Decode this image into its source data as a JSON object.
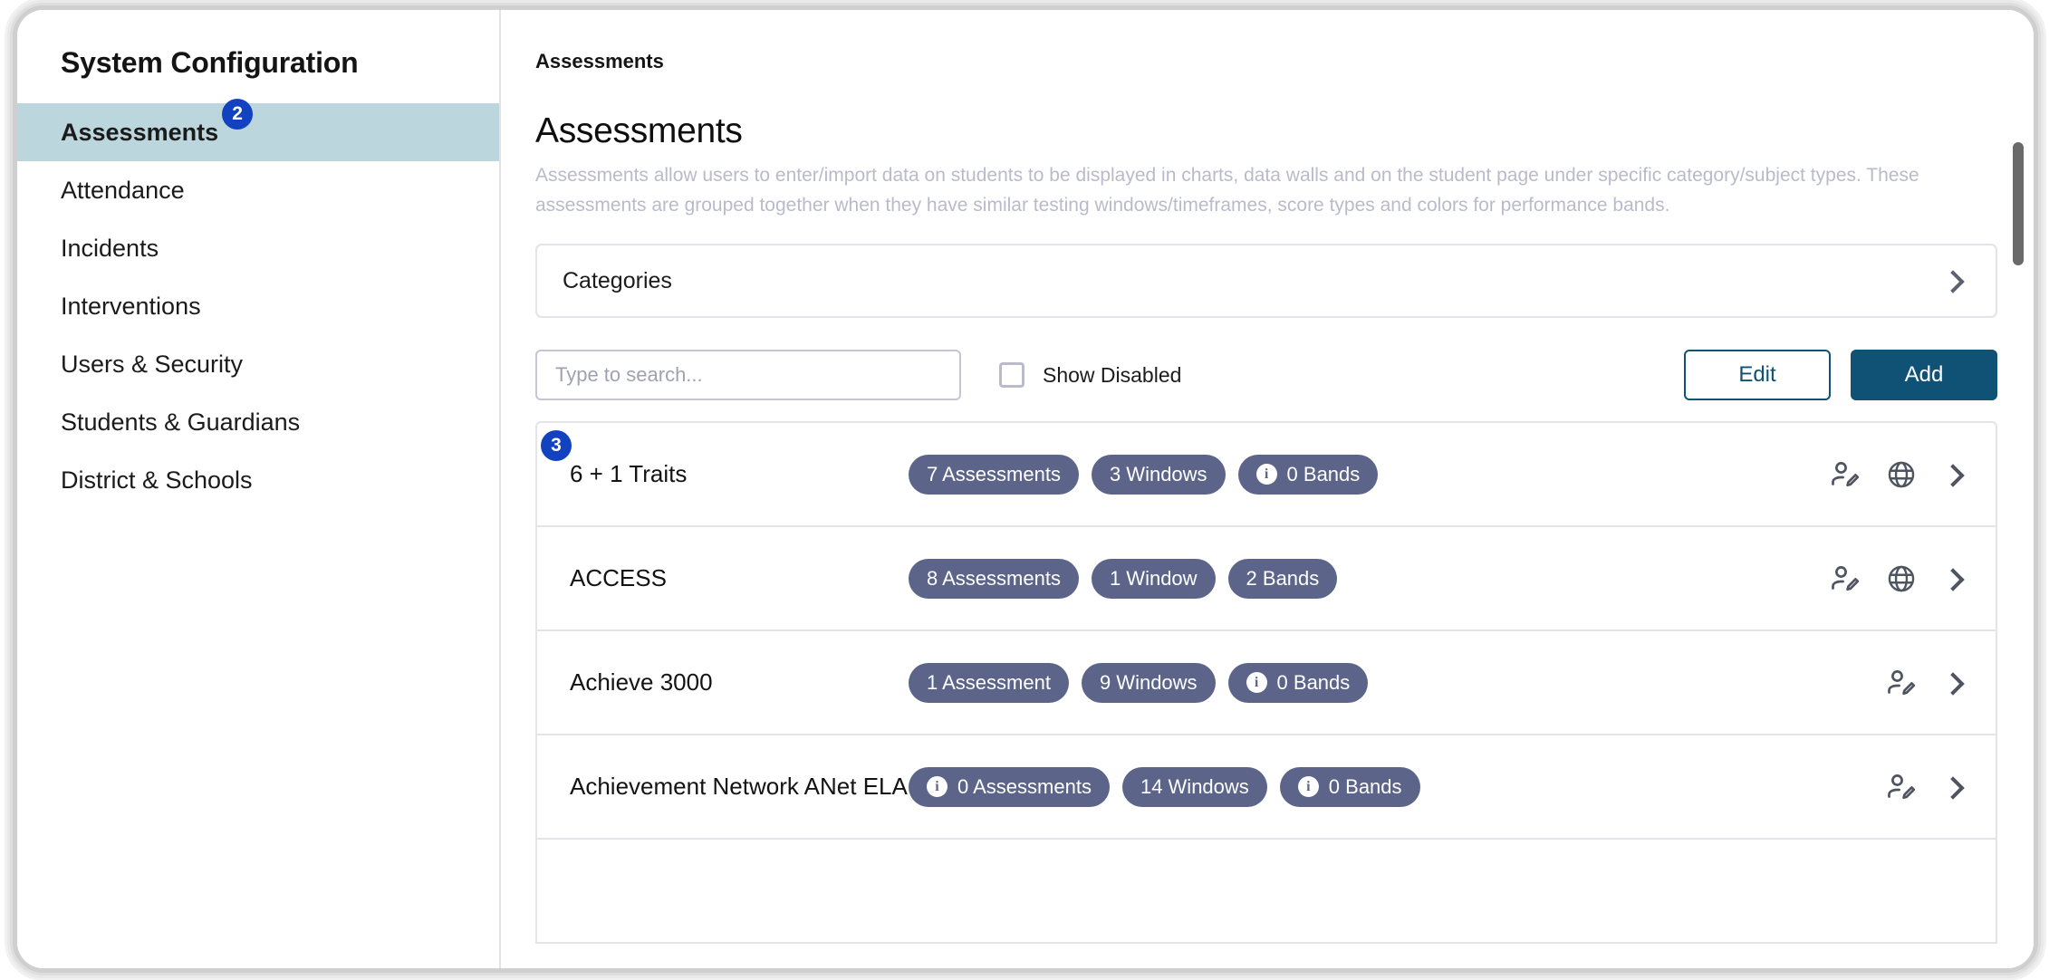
{
  "sidebar": {
    "title": "System Configuration",
    "step_badge": "2",
    "items": [
      {
        "label": "Assessments",
        "active": true
      },
      {
        "label": "Attendance",
        "active": false
      },
      {
        "label": "Incidents",
        "active": false
      },
      {
        "label": "Interventions",
        "active": false
      },
      {
        "label": "Users & Security",
        "active": false
      },
      {
        "label": "Students & Guardians",
        "active": false
      },
      {
        "label": "District & Schools",
        "active": false
      }
    ]
  },
  "main": {
    "breadcrumb": "Assessments",
    "heading": "Assessments",
    "description": "Assessments allow users to enter/import data on students to be displayed in charts, data walls and on the student page under specific category/subject types. These assessments are grouped together when they have similar testing windows/timeframes, score types and colors for performance bands.",
    "categories": {
      "label": "Categories",
      "chevron_icon": "chevron-right-icon"
    },
    "toolbar": {
      "search_placeholder": "Type to search...",
      "search_value": "",
      "show_disabled_label": "Show Disabled",
      "show_disabled_checked": false,
      "edit_label": "Edit",
      "add_label": "Add"
    },
    "list_step_badge": "3",
    "rows": [
      {
        "name": "6 + 1 Traits",
        "badges": [
          {
            "label": "7 Assessments",
            "info": false
          },
          {
            "label": "3 Windows",
            "info": false
          },
          {
            "label": "0 Bands",
            "info": true
          }
        ],
        "actions": [
          "user-edit-icon",
          "globe-icon",
          "chevron-right-icon"
        ]
      },
      {
        "name": "ACCESS",
        "badges": [
          {
            "label": "8 Assessments",
            "info": false
          },
          {
            "label": "1 Window",
            "info": false
          },
          {
            "label": "2 Bands",
            "info": false
          }
        ],
        "actions": [
          "user-edit-icon",
          "globe-icon",
          "chevron-right-icon"
        ]
      },
      {
        "name": "Achieve 3000",
        "badges": [
          {
            "label": "1 Assessment",
            "info": false
          },
          {
            "label": "9 Windows",
            "info": false
          },
          {
            "label": "0 Bands",
            "info": true
          }
        ],
        "actions": [
          "user-edit-icon",
          "chevron-right-icon"
        ]
      },
      {
        "name": "Achievement Network ANet ELA & ...",
        "badges": [
          {
            "label": "0 Assessments",
            "info": true
          },
          {
            "label": "14 Windows",
            "info": false
          },
          {
            "label": "0 Bands",
            "info": true
          }
        ],
        "actions": [
          "user-edit-icon",
          "chevron-right-icon"
        ]
      }
    ]
  },
  "colors": {
    "accent": "#0f5276",
    "badge": "#5c6589",
    "step_badge": "#1342c0",
    "active_nav": "#bcd6de",
    "muted_text": "#b9bbcb"
  }
}
